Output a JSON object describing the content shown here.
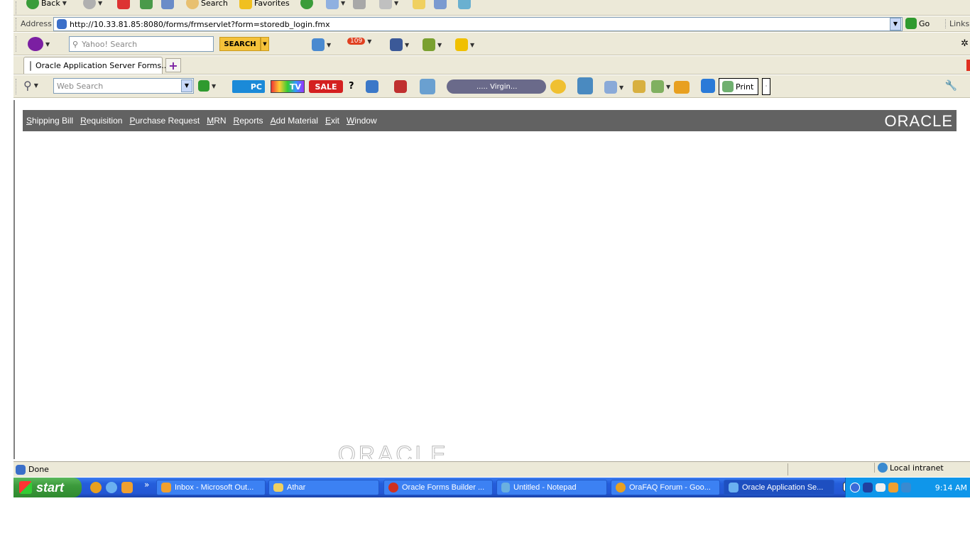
{
  "toolbar": {
    "back": "Back",
    "search": "Search",
    "favorites": "Favorites"
  },
  "address_bar": {
    "label": "Address",
    "url": "http://10.33.81.85:8080/forms/frmservlet?form=storedb_login.fmx",
    "go": "Go",
    "links": "Links"
  },
  "yahoo_toolbar": {
    "search_placeholder": "Yahoo! Search",
    "search_button": "SEARCH",
    "mail_badge": "109"
  },
  "tabs": [
    {
      "label": "Oracle Application Server Forms..."
    }
  ],
  "web_toolbar": {
    "search_placeholder": "Web Search",
    "pc_label": "PC",
    "tv_label": "TV",
    "sale_label": "SALE",
    "question": "?",
    "radio_label": "..... Virgin...",
    "print_label": "Print"
  },
  "app": {
    "menu": [
      "Shipping Bill",
      "Requisition",
      "Purchase Request",
      "MRN",
      "Reports",
      "Add Material",
      "Exit",
      "Window"
    ],
    "logo": "ORACLE",
    "watermark": "ORACLE"
  },
  "status_bar": {
    "text": "Done",
    "zone": "Local intranet"
  },
  "taskbar": {
    "start": "start",
    "chevron": "»",
    "tasks": [
      {
        "label": "Inbox - Microsoft Out..."
      },
      {
        "label": "Athar"
      },
      {
        "label": "Oracle Forms Builder ..."
      },
      {
        "label": "Untitled - Notepad"
      },
      {
        "label": "OraFAQ Forum - Goo..."
      },
      {
        "label": "Oracle Application Se..."
      }
    ],
    "clock": "9:14 AM"
  }
}
